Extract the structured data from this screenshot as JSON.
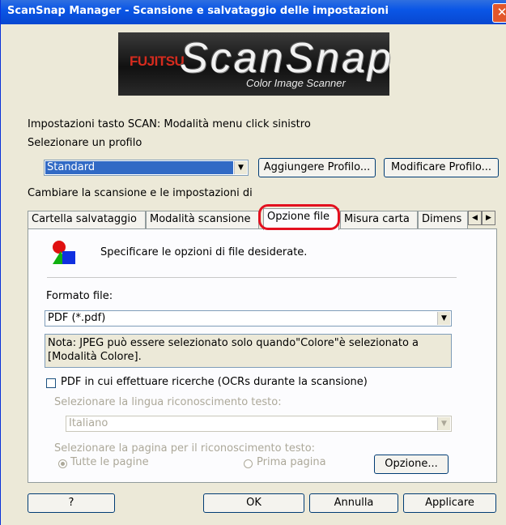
{
  "window": {
    "title": "ScanSnap Manager - Scansione e salvataggio delle impostazioni",
    "close_icon": "close-icon"
  },
  "logo": {
    "brand": "FUJITSU",
    "product": "ScanSnap",
    "tagline": "Color Image Scanner"
  },
  "scan_button_setting": "Impostazioni tasto SCAN: Modalità menu click sinistro",
  "profile": {
    "label": "Selezionare un profilo",
    "selected": "Standard",
    "add_button": "Aggiungere Profilo...",
    "modify_button": "Modificare Profilo..."
  },
  "settings_label": "Cambiare la scansione e le impostazioni di",
  "tabs": [
    {
      "label": "Cartella salvataggio"
    },
    {
      "label": "Modalità scansione"
    },
    {
      "label": "Opzione file"
    },
    {
      "label": "Misura carta"
    },
    {
      "label": "Dimens"
    }
  ],
  "active_tab": "Opzione file",
  "panel": {
    "header_text": "Specificare le opzioni di file desiderate.",
    "format_label": "Formato file:",
    "format_value": "PDF (*.pdf)",
    "note": "Nota: JPEG può essere selezionato solo quando\"Colore\"è selezionato a [Modalità Colore].",
    "searchable_pdf_label": "PDF in cui effettuare ricerche (OCRs durante la scansione)",
    "searchable_pdf_checked": false,
    "language_label": "Selezionare la lingua riconoscimento testo:",
    "language_value": "Italiano",
    "pages_label": "Selezionare la pagina per il riconoscimento testo:",
    "pages_all": "Tutte le pagine",
    "pages_first": "Prima pagina",
    "option_button": "Opzione..."
  },
  "footer": {
    "help_button": "?",
    "ok_button": "OK",
    "cancel_button": "Annulla",
    "apply_button": "Applicare"
  },
  "colors": {
    "title_bar": "#0a56e6",
    "window_bg": "#ece9d8",
    "highlight": "#e3101f",
    "selection": "#316ac5"
  }
}
